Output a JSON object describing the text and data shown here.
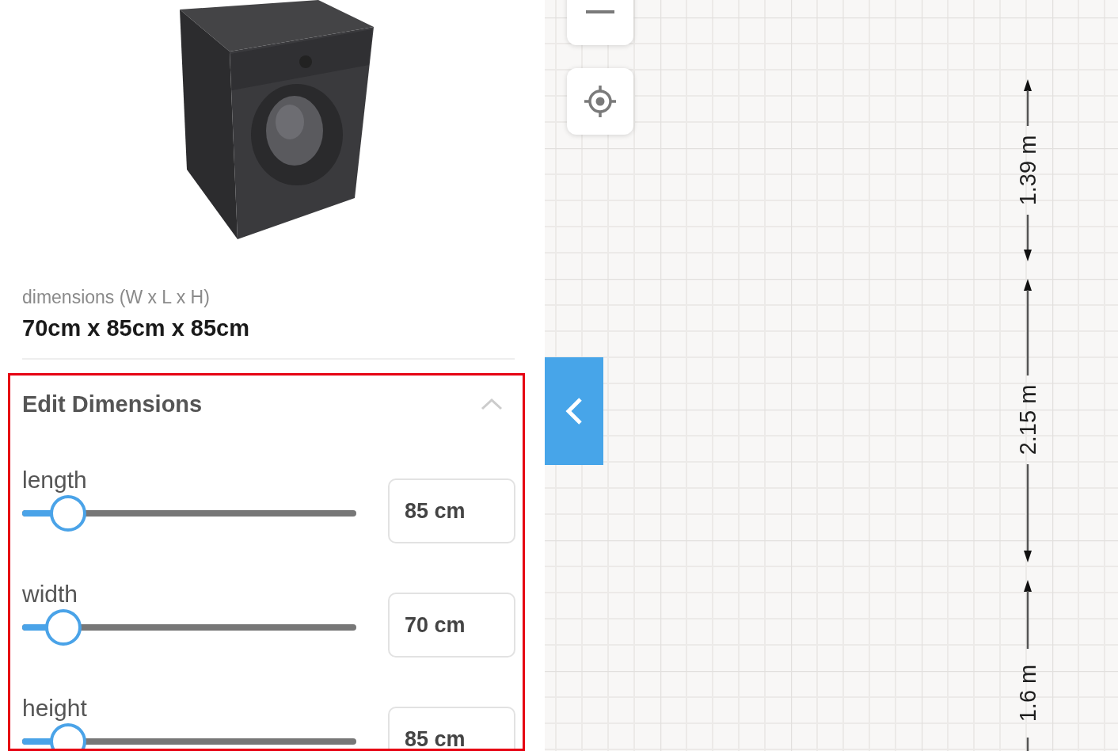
{
  "product": {
    "dimensions_label": "dimensions (W x L x H)",
    "dimensions_value": "70cm x 85cm x 85cm"
  },
  "edit_dimensions": {
    "title": "Edit Dimensions",
    "expanded": true,
    "highlighted": true,
    "fields": [
      {
        "label": "length",
        "level": 0.137,
        "value": "85 cm"
      },
      {
        "label": "width",
        "level": 0.123,
        "value": "70 cm"
      },
      {
        "label": "height",
        "level": 0.137,
        "value": "85 cm"
      }
    ]
  },
  "floor_plan": {
    "measurements": [
      {
        "label": "1.39 m"
      },
      {
        "label": "2.15 m"
      },
      {
        "label": "1.6 m"
      }
    ]
  }
}
